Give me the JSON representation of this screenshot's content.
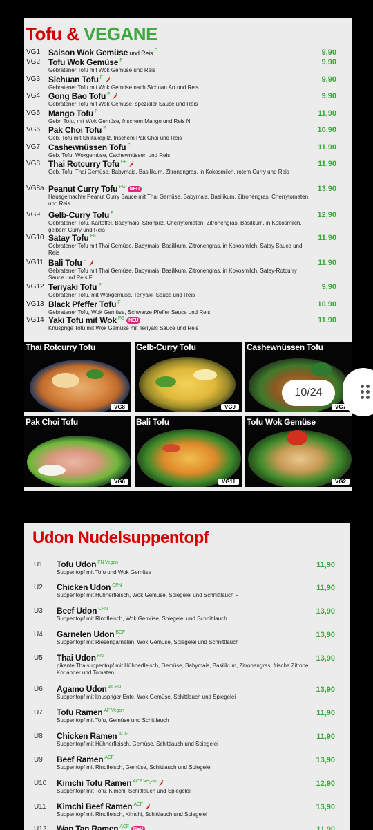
{
  "tofu_page": {
    "title_part1": "Tofu",
    "title_amp": " & ",
    "title_part2": "VEGANE",
    "items": [
      {
        "code": "VG1",
        "name": "Saison Wok Gemüse",
        "extra": " und Reis",
        "sup": "F",
        "chili": false,
        "neu": false,
        "desc": "",
        "price": "9,90"
      },
      {
        "code": "VG2",
        "name": "Tofu Wok Gemüse",
        "extra": "",
        "sup": "F",
        "chili": false,
        "neu": false,
        "desc": "Gebratener Tofu mit Wok Gemüse und Reis",
        "price": "9,90"
      },
      {
        "code": "VG3",
        "name": "Sichuan Tofu",
        "extra": "",
        "sup": "F",
        "chili": true,
        "neu": false,
        "desc": "Gebratener Tofu mit Wok Gemüse nach Sichuan Art und Reis",
        "price": "9,90"
      },
      {
        "code": "VG4",
        "name": "Gong Bao Tofu",
        "extra": "",
        "sup": "F",
        "chili": true,
        "neu": false,
        "desc": "Gebratener Tofu mit Wok Gemüse, spezialer Sauce und Reis",
        "price": "9,90"
      },
      {
        "code": "VG5",
        "name": "Mango Tofu",
        "extra": "",
        "sup": "F",
        "chili": false,
        "neu": false,
        "desc": "Gebr. Tofu, mit Wok Gemüse, frischem Mango und Reis N",
        "price": "11,90"
      },
      {
        "code": "VG6",
        "name": "Pak Choi Tofu",
        "extra": "",
        "sup": "F",
        "chili": false,
        "neu": false,
        "desc": "Geb. Tofu mit Shiitakepilz, frischem Pak Choi und Reis",
        "price": "10,90"
      },
      {
        "code": "VG7",
        "name": "Cashewnüssen Tofu",
        "extra": "",
        "sup": "FH",
        "chili": false,
        "neu": false,
        "desc": "Geb. Tofu, Wokgemüse, Cachewnüssen und Reis",
        "price": "11,90"
      },
      {
        "code": "VG8",
        "name": "Thai Rotcurry Tofu",
        "extra": "",
        "sup": "EF",
        "chili": true,
        "neu": false,
        "desc": "Geb. Tofu, Thai Gemüse, Babymais, Basilikum, Zitronengras, in Kokosmilch, rotem Curry und Reis",
        "price": "11,90"
      },
      {
        "code": "VG8a",
        "name": "Peanut Curry Tofu",
        "extra": "",
        "sup": "FG",
        "chili": false,
        "neu": true,
        "desc": "Hausgemachte Peanut Curry Sauce mit Thai Gemüse, Babymais, Basilikum, Zitronengras, Cherrytomaten und Reis",
        "price": "13,90"
      },
      {
        "code": "VG9",
        "name": "Gelb-Curry Tofu",
        "extra": "",
        "sup": "F",
        "chili": false,
        "neu": false,
        "desc": "Gebratener Tofu, Kartoffel, Babymais, Strohpilz, Cherrytomaten, Zitronengras, Basilkum, in Kokosmilch, gelbem Curry und Reis",
        "price": "12,90"
      },
      {
        "code": "VG10",
        "name": "Satay Tofu",
        "extra": "",
        "sup": "EF",
        "chili": false,
        "neu": false,
        "desc": "Gebratener Tofu mit Thai Gemüse, Babymais, Basilikum, Zitronengras, in Kokosmilch, Satay Sauce und Reis",
        "price": "11,90"
      },
      {
        "code": "VG11",
        "name": "Bali Tofu",
        "extra": "",
        "sup": "F",
        "chili": true,
        "neu": false,
        "desc": "Gebratener Tofu mit Thai Gemüse, Babymais, Basilikum, Zitronengras, in Kokosmilch, Satey-Rotcurry Sauce und Reis F",
        "price": "11,90"
      },
      {
        "code": "VG12",
        "name": "Teriyaki Tofu",
        "extra": "",
        "sup": "F",
        "chili": false,
        "neu": false,
        "desc": "Gebratener Tofu, mit Wokgemüse, Teriyaki- Sauce und Reis",
        "price": "9,90"
      },
      {
        "code": "VG13",
        "name": "Black Pfeffer Tofu",
        "extra": "",
        "sup": "F",
        "chili": false,
        "neu": false,
        "desc": "Gebratener Tofu, Wok Gemüse, Schwarze Pfeffer Sauce und Reis",
        "price": "10,90"
      },
      {
        "code": "VG14",
        "name": "Yaki Tofu mit Wok",
        "extra": "",
        "sup": "FG",
        "chili": false,
        "neu": true,
        "desc": "Knusprige Tofu mit Wok Gemüse mit Teriyaki Sauce und Reis",
        "price": "11,90"
      }
    ],
    "neu_label": "NEU"
  },
  "photos": [
    {
      "title": "Thai Rotcurry Tofu",
      "tag": "VG8"
    },
    {
      "title": "Gelb-Curry Tofu",
      "tag": "VG9"
    },
    {
      "title": "Cashewnüssen Tofu",
      "tag": "VG7"
    },
    {
      "title": "Pak Choi Tofu",
      "tag": "VG6"
    },
    {
      "title": "Bali Tofu",
      "tag": "VG11"
    },
    {
      "title": "Tofu Wok Gemüse",
      "tag": "VG2"
    }
  ],
  "pager": {
    "label": "10/24"
  },
  "udon_page": {
    "title": "Udon Nudelsuppentopf",
    "items": [
      {
        "code": "U1",
        "name": "Tofu Udon",
        "sup": "FN  Vegan",
        "chili": false,
        "neu": false,
        "desc": "Suppentopf mit Tofu und Wok Gemüse",
        "price": "11,90"
      },
      {
        "code": "U2",
        "name": "Chicken Udon",
        "sup": "CFN",
        "chili": false,
        "neu": false,
        "desc": "Suppentopf mit Hühnerfleisch, Wok Gemüse, Spiegelei und Schnittlauch F",
        "price": "11,90"
      },
      {
        "code": "U3",
        "name": "Beef Udon",
        "sup": "CFN",
        "chili": false,
        "neu": false,
        "desc": "Suppentopf mit Rindfleisch, Wok Gemüse, Spiegelei und Schnittlauch",
        "price": "13,90"
      },
      {
        "code": "U4",
        "name": "Garnelen Udon",
        "sup": "BCF",
        "chili": false,
        "neu": false,
        "desc": "Suppentopf mit Riesengarnelen, Wok Gemüse, Spiegelei und Schnittlauch",
        "price": "13,90"
      },
      {
        "code": "U5",
        "name": "Thai Udon",
        "sup": "FN",
        "chili": false,
        "neu": false,
        "desc": "pikante Thaisuppentopf mit Hühnerfleisch, Gemüse, Babymais, Basilikum, Zitronengras, frische Zitrone, Koriander und Tomaten",
        "price": "13,90"
      },
      {
        "code": "U6",
        "name": "Agamo Udon",
        "sup": "ACFN",
        "chili": false,
        "neu": false,
        "desc": "Suppentopf mit knuspriger Ente, Wok Gemüse, Schittlauch und Spiegelei",
        "price": "13,90"
      },
      {
        "code": "U7",
        "name": "Tofu Ramen",
        "sup": "AF  Vegan",
        "chili": false,
        "neu": false,
        "desc": "Suppentopf mit Tofu, Gemüse und Schittlauch",
        "price": "11,90"
      },
      {
        "code": "U8",
        "name": "Chicken Ramen",
        "sup": "ACF",
        "chili": false,
        "neu": false,
        "desc": "Suppentopf mit Hühnerfleisch, Gemüse, Schittlauch und Spiegelei",
        "price": "11,90"
      },
      {
        "code": "U9",
        "name": "Beef Ramen",
        "sup": "ACF",
        "chili": false,
        "neu": false,
        "desc": "Suppentopf mit Rindfleisch, Gemüse, Schittlauch und Spiegelei",
        "price": "13,90"
      },
      {
        "code": "U10",
        "name": "Kimchi Tofu Ramen",
        "sup": "ACF  Vegan",
        "chili": true,
        "neu": false,
        "desc": "Suppentopf mit Tofu, Kimchi, Schittlauch und Spiegelei",
        "price": "12,90"
      },
      {
        "code": "U11",
        "name": "Kimchi Beef Ramen",
        "sup": "ACF",
        "chili": true,
        "neu": false,
        "desc": "Suppentopf mit Rindfleisch, Kimchi, Schittlauch und Spiegelei",
        "price": "13,90"
      },
      {
        "code": "U12",
        "name": "Wan Tan Ramen",
        "sup": "ACF",
        "chili": false,
        "neu": true,
        "desc": "",
        "price": "11,90"
      }
    ]
  },
  "colors": {
    "title_red": "#d40000",
    "vegan_green": "#3aa83a",
    "price_green": "#3aa83a",
    "neu_pink": "#e0287a"
  },
  "icons": {
    "chili": "chili-pepper-icon",
    "more": "more-vert-dots-icon"
  }
}
